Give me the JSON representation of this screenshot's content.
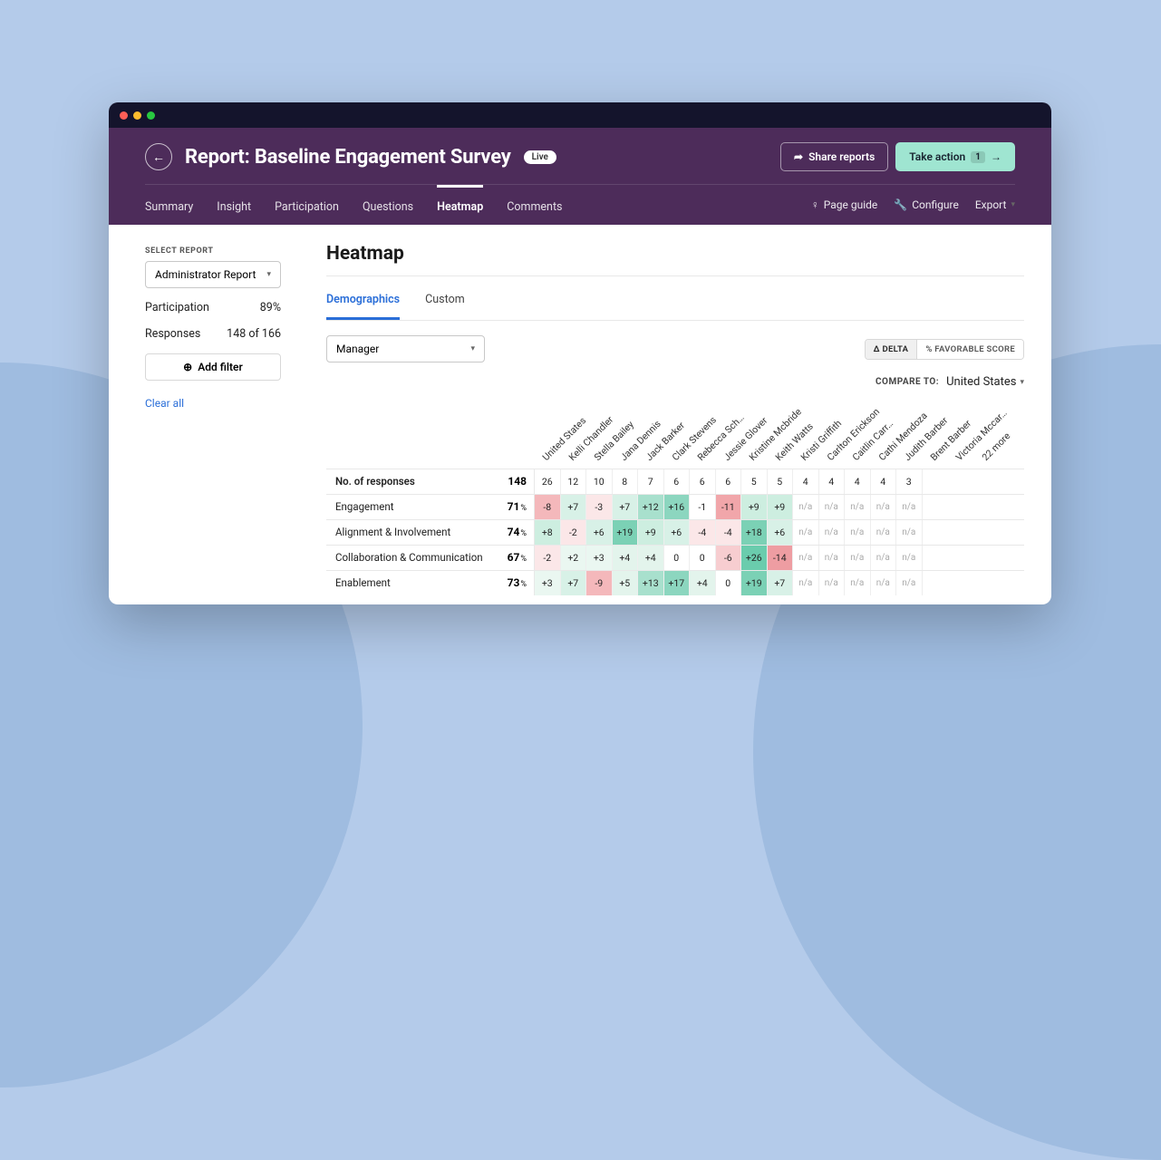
{
  "header": {
    "title": "Report: Baseline Engagement Survey",
    "badge": "Live",
    "share_label": "Share reports",
    "action_label": "Take action",
    "action_count": "1"
  },
  "nav": {
    "tabs": [
      "Summary",
      "Insight",
      "Participation",
      "Questions",
      "Heatmap",
      "Comments"
    ],
    "active": "Heatmap",
    "page_guide": "Page guide",
    "configure": "Configure",
    "export": "Export"
  },
  "sidebar": {
    "select_label": "SELECT REPORT",
    "report": "Administrator Report",
    "participation_label": "Participation",
    "participation_value": "89%",
    "responses_label": "Responses",
    "responses_value": "148 of 166",
    "add_filter": "Add filter",
    "clear": "Clear all"
  },
  "main": {
    "title": "Heatmap",
    "sub_tabs": [
      "Demographics",
      "Custom"
    ],
    "sub_active": "Demographics",
    "dropdown": "Manager",
    "toggle_delta": "Δ DELTA",
    "toggle_fav": "% FAVORABLE SCORE",
    "compare_label": "COMPARE TO:",
    "compare_value": "United States"
  },
  "heatmap": {
    "columns": [
      "United States",
      "Kelli Chandler",
      "Stella Bailey",
      "Jana Dennis",
      "Jack Barker",
      "Clark Stevens",
      "Rebecca Sch…",
      "Jessie Glover",
      "Kristine Mcbride",
      "Keith Watts",
      "Kristi Griffith",
      "Carlton Erickson",
      "Caitlin Carr…",
      "Cathi Mendoza",
      "Judith Barber",
      "Brent Barber",
      "Victoria Mccar…",
      "22 more"
    ],
    "rows": [
      {
        "label": "No. of responses",
        "bold": true,
        "score": "148",
        "pct": false,
        "cells": [
          {
            "v": "26",
            "c": ""
          },
          {
            "v": "12",
            "c": ""
          },
          {
            "v": "10",
            "c": ""
          },
          {
            "v": "8",
            "c": ""
          },
          {
            "v": "7",
            "c": ""
          },
          {
            "v": "6",
            "c": ""
          },
          {
            "v": "6",
            "c": ""
          },
          {
            "v": "6",
            "c": ""
          },
          {
            "v": "5",
            "c": ""
          },
          {
            "v": "5",
            "c": ""
          },
          {
            "v": "4",
            "c": ""
          },
          {
            "v": "4",
            "c": ""
          },
          {
            "v": "4",
            "c": ""
          },
          {
            "v": "4",
            "c": ""
          },
          {
            "v": "3",
            "c": ""
          }
        ]
      },
      {
        "label": "Engagement",
        "bold": false,
        "score": "71",
        "pct": true,
        "cells": [
          {
            "v": "-8",
            "c": "#f4b8bb"
          },
          {
            "v": "+7",
            "c": "#d8f1e7"
          },
          {
            "v": "-3",
            "c": "#fbe7e8"
          },
          {
            "v": "+7",
            "c": "#d8f1e7"
          },
          {
            "v": "+12",
            "c": "#a8e0cd"
          },
          {
            "v": "+16",
            "c": "#8cd6bf"
          },
          {
            "v": "-1",
            "c": ""
          },
          {
            "v": "-11",
            "c": "#f1a6aa"
          },
          {
            "v": "+9",
            "c": "#cdeee0"
          },
          {
            "v": "+9",
            "c": "#cdeee0"
          },
          {
            "v": "n/a",
            "c": "na"
          },
          {
            "v": "n/a",
            "c": "na"
          },
          {
            "v": "n/a",
            "c": "na"
          },
          {
            "v": "n/a",
            "c": "na"
          },
          {
            "v": "n/a",
            "c": "na"
          }
        ]
      },
      {
        "label": "Alignment & Involvement",
        "bold": false,
        "score": "74",
        "pct": true,
        "cells": [
          {
            "v": "+8",
            "c": "#cdeee0"
          },
          {
            "v": "-2",
            "c": "#fbe7e8"
          },
          {
            "v": "+6",
            "c": "#d8f1e7"
          },
          {
            "v": "+19",
            "c": "#7bd1b5"
          },
          {
            "v": "+9",
            "c": "#cdeee0"
          },
          {
            "v": "+6",
            "c": "#d8f1e7"
          },
          {
            "v": "-4",
            "c": "#fbe7e8"
          },
          {
            "v": "-4",
            "c": "#fbe7e8"
          },
          {
            "v": "+18",
            "c": "#7bd1b5"
          },
          {
            "v": "+6",
            "c": "#d8f1e7"
          },
          {
            "v": "n/a",
            "c": "na"
          },
          {
            "v": "n/a",
            "c": "na"
          },
          {
            "v": "n/a",
            "c": "na"
          },
          {
            "v": "n/a",
            "c": "na"
          },
          {
            "v": "n/a",
            "c": "na"
          }
        ]
      },
      {
        "label": "Collaboration & Communication",
        "bold": false,
        "score": "67",
        "pct": true,
        "cells": [
          {
            "v": "-2",
            "c": "#fbe7e8"
          },
          {
            "v": "+2",
            "c": "#eaf7f1"
          },
          {
            "v": "+3",
            "c": "#eaf7f1"
          },
          {
            "v": "+4",
            "c": "#e3f4ec"
          },
          {
            "v": "+4",
            "c": "#e3f4ec"
          },
          {
            "v": "0",
            "c": ""
          },
          {
            "v": "0",
            "c": ""
          },
          {
            "v": "-6",
            "c": "#f7cdd0"
          },
          {
            "v": "+26",
            "c": "#6accad"
          },
          {
            "v": "-14",
            "c": "#ee9da2"
          },
          {
            "v": "n/a",
            "c": "na"
          },
          {
            "v": "n/a",
            "c": "na"
          },
          {
            "v": "n/a",
            "c": "na"
          },
          {
            "v": "n/a",
            "c": "na"
          },
          {
            "v": "n/a",
            "c": "na"
          }
        ]
      },
      {
        "label": "Enablement",
        "bold": false,
        "score": "73",
        "pct": true,
        "cells": [
          {
            "v": "+3",
            "c": "#eaf7f1"
          },
          {
            "v": "+7",
            "c": "#d8f1e7"
          },
          {
            "v": "-9",
            "c": "#f4b8bb"
          },
          {
            "v": "+5",
            "c": "#e3f4ec"
          },
          {
            "v": "+13",
            "c": "#a8e0cd"
          },
          {
            "v": "+17",
            "c": "#8cd6bf"
          },
          {
            "v": "+4",
            "c": "#e3f4ec"
          },
          {
            "v": "0",
            "c": ""
          },
          {
            "v": "+19",
            "c": "#7bd1b5"
          },
          {
            "v": "+7",
            "c": "#d8f1e7"
          },
          {
            "v": "n/a",
            "c": "na"
          },
          {
            "v": "n/a",
            "c": "na"
          },
          {
            "v": "n/a",
            "c": "na"
          },
          {
            "v": "n/a",
            "c": "na"
          },
          {
            "v": "n/a",
            "c": "na"
          }
        ]
      }
    ]
  }
}
